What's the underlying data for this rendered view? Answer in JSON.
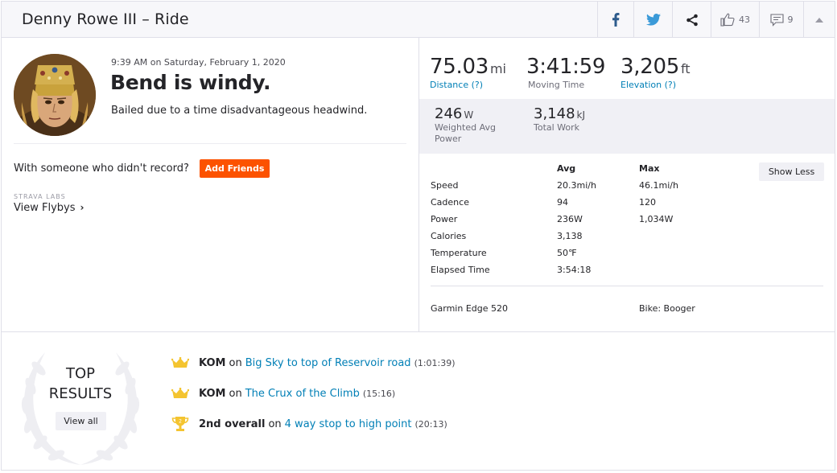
{
  "header": {
    "title": "Denny Rowe III – Ride",
    "kudos_count": "43",
    "comments_count": "9"
  },
  "activity": {
    "time": "9:39 AM on Saturday, February 1, 2020",
    "title": "Bend is windy.",
    "description": "Bailed due to a time disadvantageous headwind.",
    "with_someone": "With someone who didn't record?",
    "add_friends": "Add Friends",
    "labs": "STRAVA LABS",
    "flybys": "View Flybys"
  },
  "stats": {
    "distance": {
      "value": "75.03",
      "unit": "mi",
      "label": "Distance (?)"
    },
    "moving_time": {
      "value": "3:41:59",
      "label": "Moving Time"
    },
    "elevation": {
      "value": "3,205",
      "unit": "ft",
      "label": "Elevation (?)"
    },
    "power": {
      "value": "246",
      "unit": "W",
      "label_1": "Weighted Avg",
      "label_2": "Power"
    },
    "work": {
      "value": "3,148",
      "unit": "kJ",
      "label": "Total Work"
    }
  },
  "details": {
    "show_less": "Show Less",
    "col_avg": "Avg",
    "col_max": "Max",
    "rows": [
      {
        "name": "Speed",
        "avg": "20.3mi/h",
        "max": "46.1mi/h"
      },
      {
        "name": "Cadence",
        "avg": "94",
        "max": "120"
      },
      {
        "name": "Power",
        "avg": "236W",
        "max": "1,034W"
      },
      {
        "name": "Calories",
        "avg": "3,138",
        "max": ""
      },
      {
        "name": "Temperature",
        "avg": "50℉",
        "max": ""
      },
      {
        "name": "Elapsed Time",
        "avg": "3:54:18",
        "max": ""
      }
    ],
    "device": "Garmin Edge 520",
    "bike": "Bike: Booger"
  },
  "results": {
    "title_1": "TOP",
    "title_2": "RESULTS",
    "view_all": "View all",
    "items": [
      {
        "kind": "KOM",
        "on": "on",
        "segment": "Big Sky to top of Reservoir road",
        "time": "(1:01:39)",
        "icon": "crown-icon"
      },
      {
        "kind": "KOM",
        "on": "on",
        "segment": "The Crux of the Climb",
        "time": "(15:16)",
        "icon": "crown-icon"
      },
      {
        "kind": "2nd overall",
        "on": "on",
        "segment": "4 way stop to high point",
        "time": "(20:13)",
        "icon": "trophy-icon"
      }
    ]
  },
  "colors": {
    "accent": "#fc5200",
    "link": "#007fb6",
    "crown": "#f4c430"
  }
}
